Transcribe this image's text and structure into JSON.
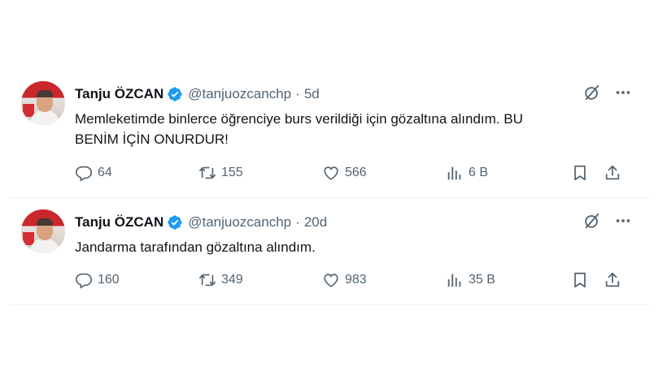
{
  "tweets": [
    {
      "author_name": "Tanju ÖZCAN",
      "handle": "@tanjuozcanchp",
      "separator": "·",
      "time": "5d",
      "text": "Memleketimde binlerce öğrenciye burs verildiği için gözaltına alındım. BU\nBENİM İÇİN ONURDUR!",
      "replies": "64",
      "retweets": "155",
      "likes": "566",
      "views": "6 B"
    },
    {
      "author_name": "Tanju ÖZCAN",
      "handle": "@tanjuozcanchp",
      "separator": "·",
      "time": "20d",
      "text": "Jandarma tarafından gözaltına alındım.",
      "replies": "160",
      "retweets": "349",
      "likes": "983",
      "views": "35 B"
    }
  ],
  "colors": {
    "text_primary": "#0f1419",
    "text_secondary": "#536471",
    "verified_blue": "#1d9bf0",
    "divider": "#eff3f4"
  },
  "icons": [
    "verified-badge-icon",
    "grok-icon",
    "more-icon",
    "reply-icon",
    "retweet-icon",
    "like-icon",
    "views-icon",
    "bookmark-icon",
    "share-icon"
  ]
}
